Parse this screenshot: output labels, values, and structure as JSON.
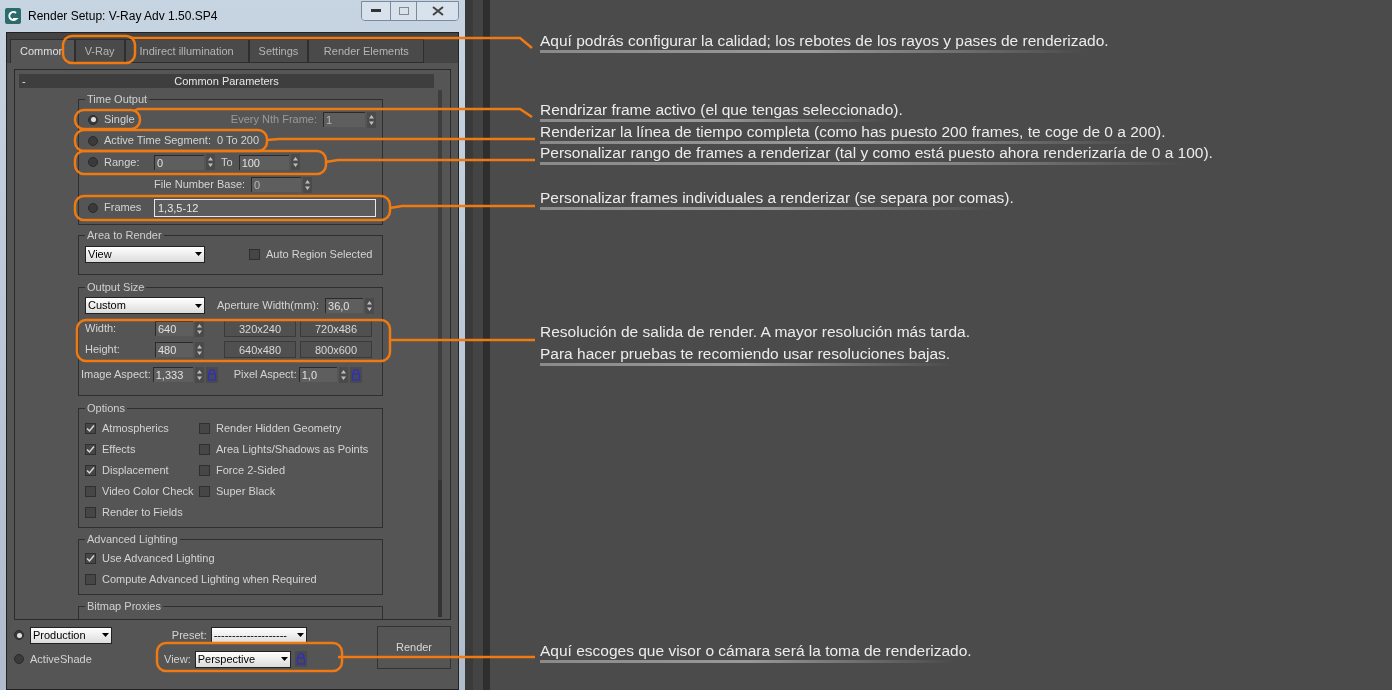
{
  "window": {
    "title": "Render Setup: V-Ray Adv 1.50.SP4"
  },
  "tabs": [
    {
      "label": "Common",
      "selected": true
    },
    {
      "label": "V-Ray",
      "selected": false
    },
    {
      "label": "Indirect illumination",
      "selected": false
    },
    {
      "label": "Settings",
      "selected": false
    },
    {
      "label": "Render Elements",
      "selected": false
    }
  ],
  "rollout": {
    "sign": "-",
    "title": "Common Parameters"
  },
  "time_output": {
    "title": "Time Output",
    "single": {
      "label": "Single",
      "selected": true
    },
    "every_nth": {
      "label": "Every Nth Frame:",
      "value": "1",
      "disabled": true
    },
    "active_segment": {
      "label": "Active Time Segment:",
      "value": "0 To 200",
      "selected": false
    },
    "range": {
      "label": "Range:",
      "from": "0",
      "to_label": "To",
      "to": "100",
      "selected": false
    },
    "file_number_base": {
      "label": "File Number Base:",
      "value": "0",
      "disabled": true
    },
    "frames": {
      "label": "Frames",
      "value": "1,3,5-12",
      "selected": false
    }
  },
  "area_to_render": {
    "title": "Area to Render",
    "dropdown": "View",
    "auto_region": {
      "label": "Auto Region Selected",
      "checked": false
    }
  },
  "output_size": {
    "title": "Output Size",
    "dropdown": "Custom",
    "aperture": {
      "label": "Aperture Width(mm):",
      "value": "36,0"
    },
    "width": {
      "label": "Width:",
      "value": "640"
    },
    "height": {
      "label": "Height:",
      "value": "480"
    },
    "presets": [
      "320x240",
      "720x486",
      "640x480",
      "800x600"
    ],
    "image_aspect": {
      "label": "Image Aspect:",
      "value": "1,333"
    },
    "pixel_aspect": {
      "label": "Pixel Aspect:",
      "value": "1,0"
    }
  },
  "options": {
    "title": "Options",
    "left": [
      {
        "label": "Atmospherics",
        "checked": true
      },
      {
        "label": "Effects",
        "checked": true
      },
      {
        "label": "Displacement",
        "checked": true
      },
      {
        "label": "Video Color Check",
        "checked": false
      },
      {
        "label": "Render to Fields",
        "checked": false
      }
    ],
    "right": [
      {
        "label": "Render Hidden Geometry",
        "checked": false
      },
      {
        "label": "Area Lights/Shadows as Points",
        "checked": false
      },
      {
        "label": "Force 2-Sided",
        "checked": false
      },
      {
        "label": "Super Black",
        "checked": false
      }
    ]
  },
  "advanced_lighting": {
    "title": "Advanced Lighting",
    "items": [
      {
        "label": "Use Advanced Lighting",
        "checked": true
      },
      {
        "label": "Compute Advanced Lighting when Required",
        "checked": false
      }
    ]
  },
  "bitmap_proxies": {
    "title": "Bitmap Proxies"
  },
  "bottom": {
    "modes": [
      {
        "kind": "dropdown",
        "label": "Production",
        "selected": true
      },
      {
        "kind": "label",
        "label": "ActiveShade",
        "selected": false
      }
    ],
    "preset": {
      "label": "Preset:",
      "value": "--------------------"
    },
    "view": {
      "label": "View:",
      "value": "Perspective"
    },
    "render_button": "Render"
  },
  "annotations": [
    {
      "lines": [
        "Aquí podrás configurar la calidad; los rebotes de los rayos y pases de renderizado."
      ]
    },
    {
      "lines": [
        "Rendrizar frame activo (el que tengas seleccionado)."
      ]
    },
    {
      "lines": [
        "Renderizar la línea de tiempo completa (como has puesto 200 frames, te coge de 0 a 200)."
      ]
    },
    {
      "lines": [
        "Personalizar rango de frames a renderizar (tal y como está puesto ahora renderizaría de 0 a 100)."
      ]
    },
    {
      "lines": [
        "Personalizar frames individuales a renderizar (se separa por comas)."
      ]
    },
    {
      "lines": [
        "Resolución de salida de render. A mayor resolución más tarda.",
        "Para hacer pruebas te recomiendo usar resoluciones bajas."
      ]
    },
    {
      "lines": [
        "Aquí escoges que visor o cámara será la toma de renderizado."
      ]
    }
  ]
}
